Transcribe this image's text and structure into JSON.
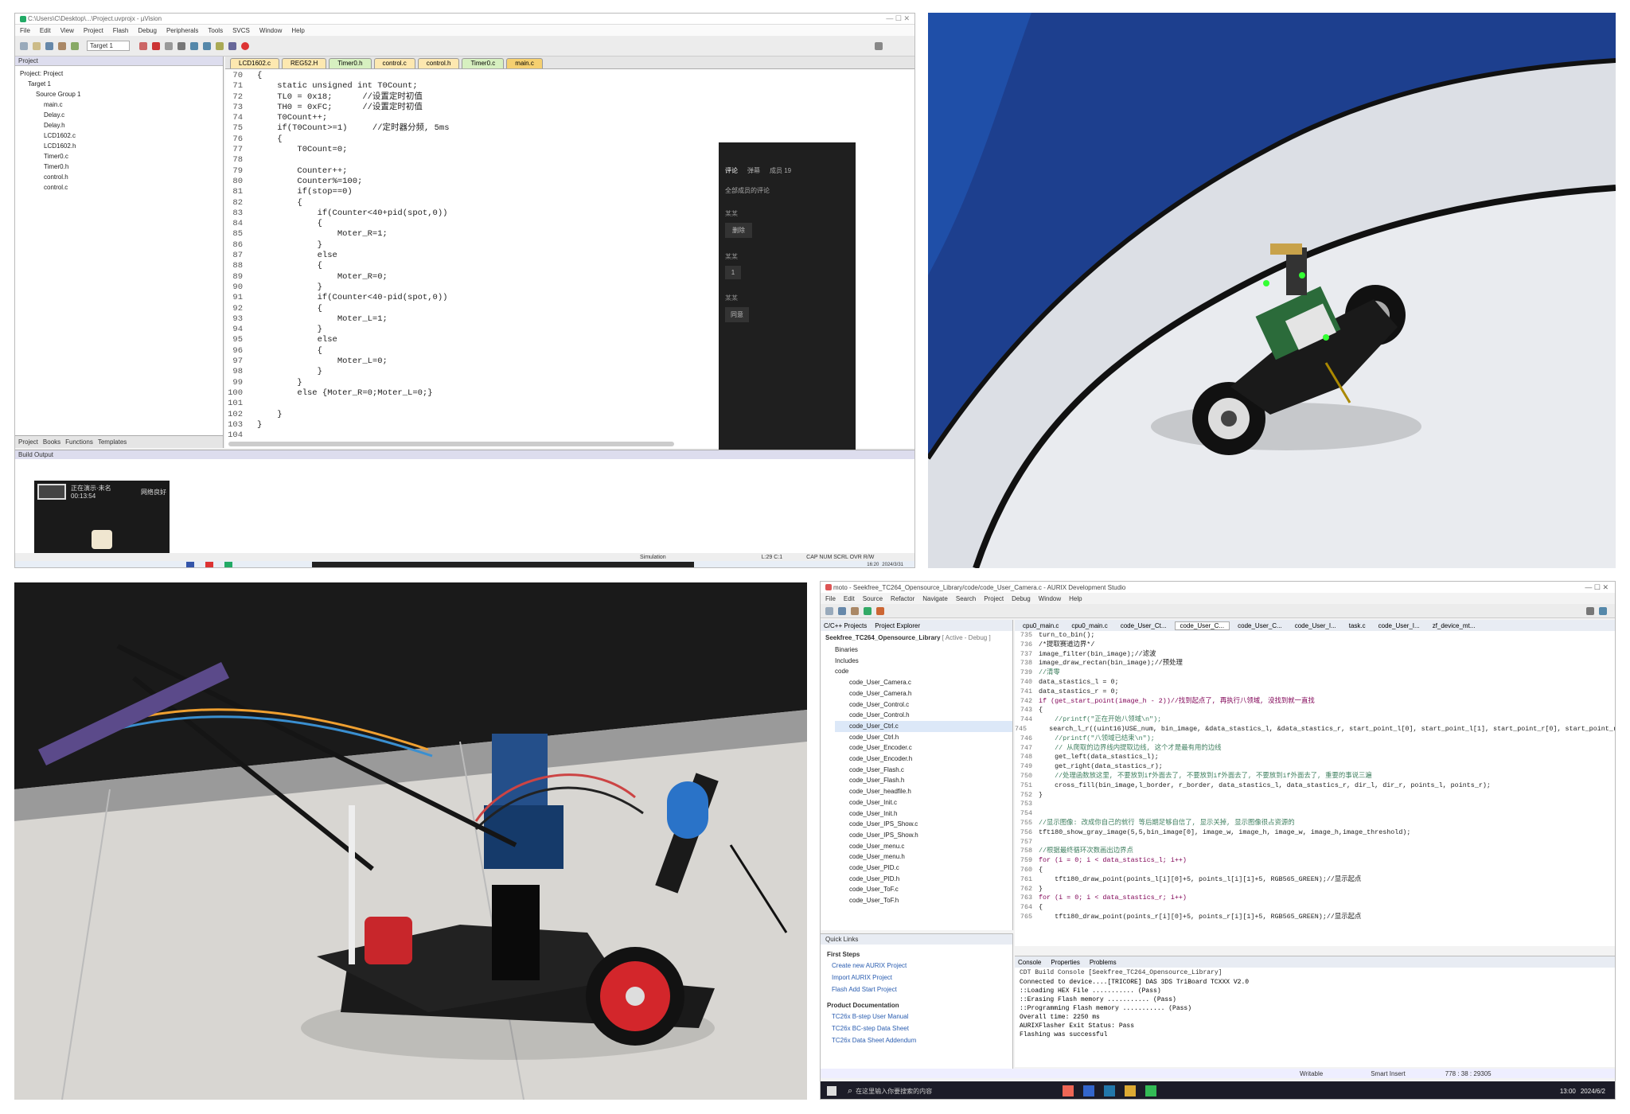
{
  "keil": {
    "title": "C:\\Users\\C\\Desktop\\...\\Project.uvprojx - µVision",
    "menu": [
      "File",
      "Edit",
      "View",
      "Project",
      "Flash",
      "Debug",
      "Peripherals",
      "Tools",
      "SVCS",
      "Window",
      "Help"
    ],
    "target": "Target 1",
    "tabs": [
      "LCD1602.c",
      "REG52.H",
      "Timer0.h",
      "control.c",
      "control.h",
      "Timer0.c",
      "main.c"
    ],
    "project_label": "Project",
    "tree": [
      "Project: Project",
      "Target 1",
      "Source Group 1",
      "main.c",
      "Delay.c",
      "Delay.h",
      "LCD1602.c",
      "LCD1602.h",
      "Timer0.c",
      "Timer0.h",
      "control.h",
      "control.c"
    ],
    "bottom_tabs": [
      "Project",
      "Books",
      "Functions",
      "Templates"
    ],
    "build_output": "Build Output",
    "status_sim": "Simulation",
    "status_pos": "L:29 C:1",
    "status_caps": "CAP NUM SCRL OVR R/W",
    "code": [
      {
        "n": "70",
        "t": "{"
      },
      {
        "n": "71",
        "t": "    static unsigned int T0Count;"
      },
      {
        "n": "72",
        "t": "    TL0 = 0x18;      //设置定时初值"
      },
      {
        "n": "73",
        "t": "    TH0 = 0xFC;      //设置定时初值"
      },
      {
        "n": "74",
        "t": "    T0Count++;"
      },
      {
        "n": "75",
        "t": "    if(T0Count>=1)     //定时器分频, 5ms"
      },
      {
        "n": "76",
        "t": "    {"
      },
      {
        "n": "77",
        "t": "        T0Count=0;"
      },
      {
        "n": "78",
        "t": ""
      },
      {
        "n": "79",
        "t": "        Counter++;"
      },
      {
        "n": "80",
        "t": "        Counter%=100;"
      },
      {
        "n": "81",
        "t": "        if(stop==0)"
      },
      {
        "n": "82",
        "t": "        {"
      },
      {
        "n": "83",
        "t": "            if(Counter<40+pid(spot,0))"
      },
      {
        "n": "84",
        "t": "            {"
      },
      {
        "n": "85",
        "t": "                Moter_R=1;"
      },
      {
        "n": "86",
        "t": "            }"
      },
      {
        "n": "87",
        "t": "            else"
      },
      {
        "n": "88",
        "t": "            {"
      },
      {
        "n": "89",
        "t": "                Moter_R=0;"
      },
      {
        "n": "90",
        "t": "            }"
      },
      {
        "n": "91",
        "t": "            if(Counter<40-pid(spot,0))"
      },
      {
        "n": "92",
        "t": "            {"
      },
      {
        "n": "93",
        "t": "                Moter_L=1;"
      },
      {
        "n": "94",
        "t": "            }"
      },
      {
        "n": "95",
        "t": "            else"
      },
      {
        "n": "96",
        "t": "            {"
      },
      {
        "n": "97",
        "t": "                Moter_L=0;"
      },
      {
        "n": "98",
        "t": "            }"
      },
      {
        "n": "99",
        "t": "        }"
      },
      {
        "n": "100",
        "t": "        else {Moter_R=0;Moter_L=0;}"
      },
      {
        "n": "101",
        "t": ""
      },
      {
        "n": "102",
        "t": "    }"
      },
      {
        "n": "103",
        "t": "}"
      },
      {
        "n": "104",
        "t": ""
      }
    ],
    "chat": {
      "tabs": [
        "评论",
        "弹幕",
        "成员 19"
      ],
      "filter": "全部成员的评论",
      "row1": "某某",
      "btn1": "删除",
      "row2": "某某",
      "btn2": "1",
      "row3": "某某",
      "btn3": "同意"
    },
    "video_pip": {
      "label": "正在演示·未名",
      "time": "00:13:54",
      "signal": "网络良好"
    },
    "clock": {
      "time": "16:20",
      "date": "2024/3/31"
    }
  },
  "aurix": {
    "title": "moto - Seekfree_TC264_Opensource_Library/code/code_User_Camera.c - AURIX Development Studio",
    "menu": [
      "File",
      "Edit",
      "Source",
      "Refactor",
      "Navigate",
      "Search",
      "Project",
      "Debug",
      "Window",
      "Help"
    ],
    "explorer_tabs": [
      "C/C++ Projects",
      "Project Explorer"
    ],
    "project": "Seekfree_TC264_Opensource_Library",
    "project_suffix": "[ Active - Debug ]",
    "tree": [
      "Binaries",
      "Includes",
      "code",
      "code_User_Camera.c",
      "code_User_Camera.h",
      "code_User_Control.c",
      "code_User_Control.h",
      "code_User_Ctrl.c",
      "code_User_Ctrl.h",
      "code_User_Encoder.c",
      "code_User_Encoder.h",
      "code_User_Flash.c",
      "code_User_Flash.h",
      "code_User_headfile.h",
      "code_User_Init.c",
      "code_User_Init.h",
      "code_User_IPS_Show.c",
      "code_User_IPS_Show.h",
      "code_User_menu.c",
      "code_User_menu.h",
      "code_User_PID.c",
      "code_User_PID.h",
      "code_User_ToF.c",
      "code_User_ToF.h"
    ],
    "editor_tabs": [
      "cpu0_main.c",
      "cpu0_main.c",
      "code_User_Ct...",
      "code_User_C...",
      "code_User_C...",
      "code_User_I...",
      "task.c",
      "code_User_I...",
      "zf_device_mt..."
    ],
    "code": [
      {
        "n": "735",
        "t": "turn_to_bin();"
      },
      {
        "n": "736",
        "t": "/*提取赛道边界*/"
      },
      {
        "n": "737",
        "t": "image_filter(bin_image);//滤波"
      },
      {
        "n": "738",
        "t": "image_draw_rectan(bin_image);//预处理"
      },
      {
        "n": "739",
        "t": "//清零"
      },
      {
        "n": "740",
        "t": "data_stastics_l = 0;"
      },
      {
        "n": "741",
        "t": "data_stastics_r = 0;"
      },
      {
        "n": "742",
        "t": "if (get_start_point(image_h - 2))//找到起点了, 再执行八领域, 没找到就一直找"
      },
      {
        "n": "743",
        "t": "{"
      },
      {
        "n": "744",
        "t": "    //printf(\"正在开始八领域\\n\");"
      },
      {
        "n": "745",
        "t": "    search_l_r((uint16)USE_num, bin_image, &data_stastics_l, &data_stastics_r, start_point_l[0], start_point_l[1], start_point_r[0], start_point_r[1],"
      },
      {
        "n": "746",
        "t": "    //printf(\"八领域已结束\\n\");"
      },
      {
        "n": "747",
        "t": "    // 从爬取的边界线内提取边线, 这个才是最有用的边线"
      },
      {
        "n": "748",
        "t": "    get_left(data_stastics_l);"
      },
      {
        "n": "749",
        "t": "    get_right(data_stastics_r);"
      },
      {
        "n": "750",
        "t": "    //处理函数放这里, 不要放到if外面去了, 不要放到if外面去了, 不要放到if外面去了, 重要的事说三遍"
      },
      {
        "n": "751",
        "t": "    cross_fill(bin_image,l_border, r_border, data_stastics_l, data_stastics_r, dir_l, dir_r, points_l, points_r);"
      },
      {
        "n": "752",
        "t": "}"
      },
      {
        "n": "753",
        "t": ""
      },
      {
        "n": "754",
        "t": ""
      },
      {
        "n": "755",
        "t": "//显示图像: 改成你自己的就行 等后期足够自信了, 显示关掉, 显示图像很占资源的"
      },
      {
        "n": "756",
        "t": "tft180_show_gray_image(5,5,bin_image[0], image_w, image_h, image_w, image_h,image_threshold);"
      },
      {
        "n": "757",
        "t": ""
      },
      {
        "n": "758",
        "t": "//根据最终循环次数画出边界点"
      },
      {
        "n": "759",
        "t": "for (i = 0; i < data_stastics_l; i++)"
      },
      {
        "n": "760",
        "t": "{"
      },
      {
        "n": "761",
        "t": "    tft180_draw_point(points_l[i][0]+5, points_l[i][1]+5, RGB565_GREEN);//显示起点"
      },
      {
        "n": "762",
        "t": "}"
      },
      {
        "n": "763",
        "t": "for (i = 0; i < data_stastics_r; i++)"
      },
      {
        "n": "764",
        "t": "{"
      },
      {
        "n": "765",
        "t": "    tft180_draw_point(points_r[i][0]+5, points_r[i][1]+5, RGB565_GREEN);//显示起点"
      }
    ],
    "quick_links": {
      "tab": "Quick Links",
      "first_steps": "First Steps",
      "items": [
        "Create new AURIX Project",
        "Import AURIX Project",
        "Flash Add Start Project"
      ],
      "product_docs": "Product Documentation",
      "docs": [
        "TC26x B-step User Manual",
        "TC26x BC-step Data Sheet",
        "TC26x Data Sheet Addendum"
      ]
    },
    "console": {
      "tabs": [
        "Console",
        "Properties",
        "Problems"
      ],
      "header": "CDT Build Console [Seekfree_TC264_Opensource_Library]",
      "lines": [
        "Connected to device....[TRICORE] DAS 3DS TriBoard TCXXX V2.0",
        "::Loading HEX File ........... (Pass)",
        "::Erasing Flash memory ........... (Pass)",
        "::Programming Flash memory ........... (Pass)",
        "Overall time: 2250 ms",
        "AURIXFlasher Exit Status: Pass",
        "Flashing was successful"
      ]
    },
    "status": {
      "writable": "Writable",
      "insert": "Smart Insert",
      "pos": "778 : 38 : 29305"
    },
    "taskbar": {
      "search": "在这里输入你要搜索的内容",
      "time": "13:00",
      "date": "2024/6/2"
    }
  },
  "photos": {
    "moto": "self-balancing motorcycle robot on track",
    "car": "line-following robot car with sensor arm"
  },
  "colors": {
    "track_blue": "#1f4fa8",
    "track_white": "#e8eaee",
    "keyword": "#0000c8",
    "comment": "#008000"
  }
}
